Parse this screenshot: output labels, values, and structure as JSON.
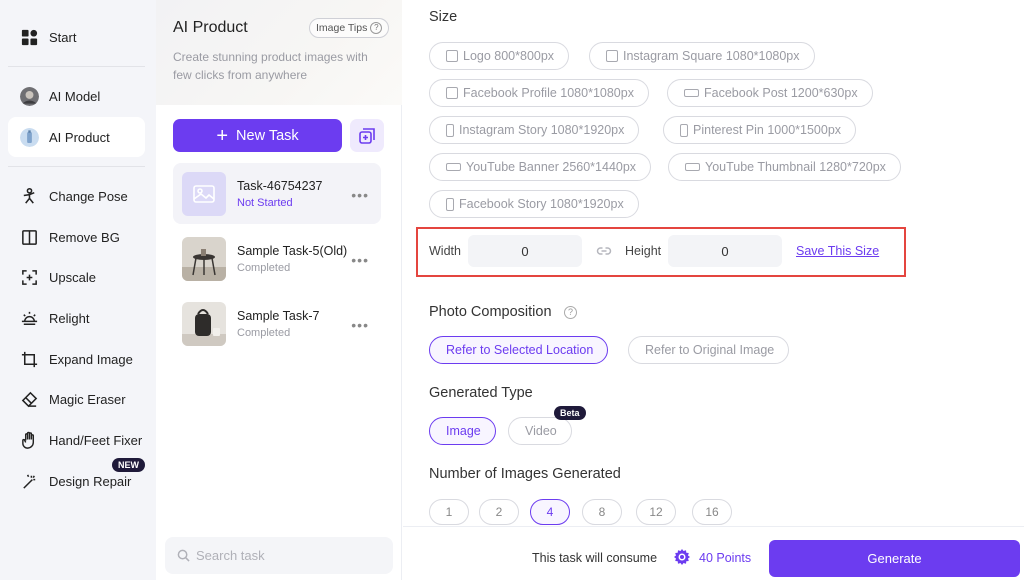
{
  "nav": {
    "start": "Start",
    "ai_model": "AI Model",
    "ai_product": "AI Product",
    "change_pose": "Change Pose",
    "remove_bg": "Remove BG",
    "upscale": "Upscale",
    "relight": "Relight",
    "expand_image": "Expand Image",
    "magic_eraser": "Magic Eraser",
    "hand_feet_fixer": "Hand/Feet Fixer",
    "design_repair": "Design Repair",
    "new_badge": "NEW"
  },
  "panel": {
    "title": "AI Product",
    "tips": "Image Tips",
    "description": "Create stunning product images with few clicks from anywhere",
    "new_task": "New Task",
    "tasks": [
      {
        "name": "Task-46754237",
        "status": "Not Started"
      },
      {
        "name": "Sample Task-5(Old)",
        "status": "Completed"
      },
      {
        "name": "Sample Task-7",
        "status": "Completed"
      }
    ],
    "search_placeholder": "Search task"
  },
  "main": {
    "size_title": "Size",
    "sizes": [
      {
        "label": "Logo 800*800px",
        "shape": "sq"
      },
      {
        "label": "Instagram Square 1080*1080px",
        "shape": "sq"
      },
      {
        "label": "Facebook Profile 1080*1080px",
        "shape": "sq"
      },
      {
        "label": "Facebook Post 1200*630px",
        "shape": "wide"
      },
      {
        "label": "Instagram Story 1080*1920px",
        "shape": "tall"
      },
      {
        "label": "Pinterest Pin 1000*1500px",
        "shape": "tall"
      },
      {
        "label": "YouTube Banner 2560*1440px",
        "shape": "wide"
      },
      {
        "label": "YouTube Thumbnail 1280*720px",
        "shape": "wide"
      },
      {
        "label": "Facebook Story 1080*1920px",
        "shape": "tall"
      }
    ],
    "width_label": "Width",
    "width_value": "0",
    "height_label": "Height",
    "height_value": "0",
    "save_size": "Save This Size",
    "composition_title": "Photo Composition",
    "composition_options": [
      "Refer to Selected Location",
      "Refer to Original Image"
    ],
    "composition_selected": 0,
    "generated_type_title": "Generated Type",
    "generated_types": [
      "Image",
      "Video"
    ],
    "generated_type_selected": 0,
    "beta": "Beta",
    "num_images_title": "Number of Images Generated",
    "num_options": [
      "1",
      "2",
      "4",
      "8",
      "12",
      "16"
    ],
    "num_selected": 2,
    "consume_text": "This task will consume",
    "points": "40 Points",
    "generate": "Generate"
  },
  "colors": {
    "accent": "#6c3cf0",
    "highlight_box": "#e4453f",
    "nav_bg": "#f4f5f9"
  }
}
